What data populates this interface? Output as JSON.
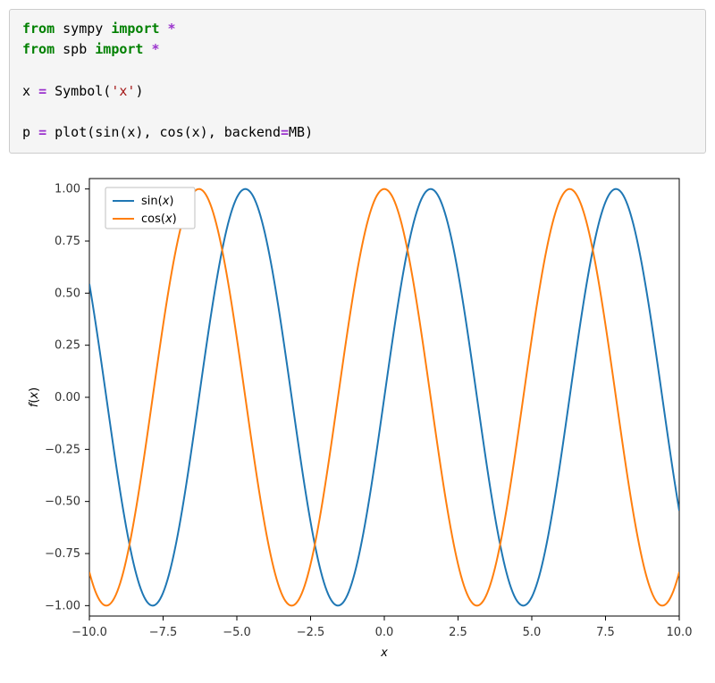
{
  "code": {
    "line1_from": "from",
    "line1_mod": " sympy ",
    "line1_import": "import",
    "line1_star": " *",
    "line2_from": "from",
    "line2_mod": " spb ",
    "line2_import": "import",
    "line2_star": " *",
    "line4_a": "x ",
    "line4_eq": "=",
    "line4_b": " Symbol(",
    "line4_str": "'x'",
    "line4_c": ")",
    "line6_a": "p ",
    "line6_eq": "=",
    "line6_b": " plot(sin(x), cos(x), backend",
    "line6_eq2": "=",
    "line6_c": "MB)"
  },
  "chart_data": {
    "type": "line",
    "xlabel": "x",
    "ylabel": "f(x)",
    "xlim": [
      -10,
      10
    ],
    "ylim": [
      -1.05,
      1.05
    ],
    "xticks": [
      -10.0,
      -7.5,
      -5.0,
      -2.5,
      0.0,
      2.5,
      5.0,
      7.5,
      10.0
    ],
    "xtick_labels": [
      "−10.0",
      "−7.5",
      "−5.0",
      "−2.5",
      "0.0",
      "2.5",
      "5.0",
      "7.5",
      "10.0"
    ],
    "yticks": [
      -1.0,
      -0.75,
      -0.5,
      -0.25,
      0.0,
      0.25,
      0.5,
      0.75,
      1.0
    ],
    "ytick_labels": [
      "−1.00",
      "−0.75",
      "−0.50",
      "−0.25",
      "0.00",
      "0.25",
      "0.50",
      "0.75",
      "1.00"
    ],
    "legend_position": "upper-left",
    "series": [
      {
        "name": "sin(x)",
        "fn": "sin",
        "color": "#1f77b4"
      },
      {
        "name": "cos(x)",
        "fn": "cos",
        "color": "#ff7f0e"
      }
    ]
  }
}
